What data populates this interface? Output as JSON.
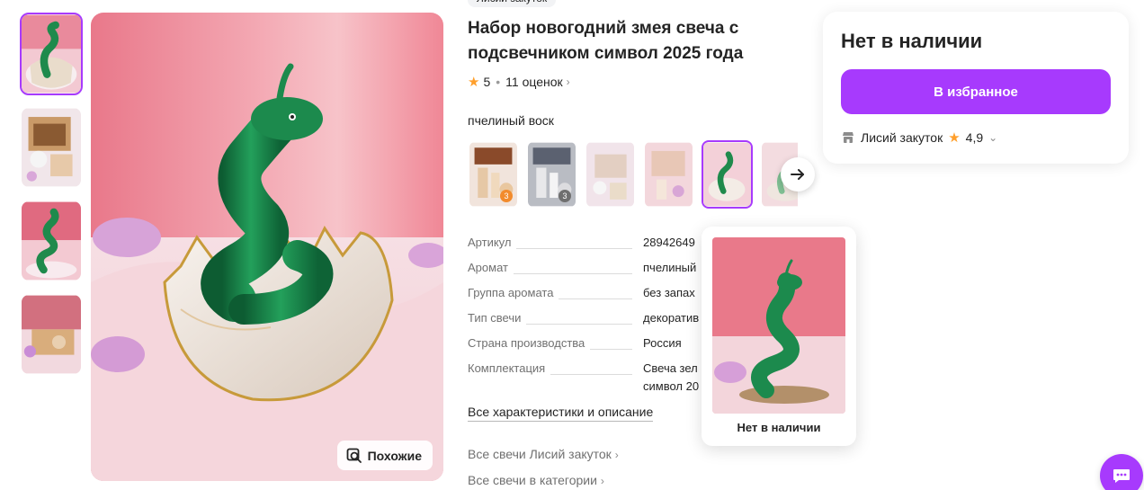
{
  "brand": {
    "label": "Лисий закуток"
  },
  "product": {
    "title": "Набор новогодний змея свеча с подсвечником символ 2025 года",
    "rating": "5",
    "reviews": "11 оценок"
  },
  "gallery": {
    "thumbnails": [
      "snake-in-egg",
      "gift-box",
      "snake-candle",
      "box-with-logo"
    ],
    "similar_label": "Похожие"
  },
  "variants": {
    "label": "пчелиный воск",
    "items": [
      {
        "image": "candles-set-orange",
        "badge": "3"
      },
      {
        "image": "candles-set-grey",
        "badge": "3"
      },
      {
        "image": "gift-box"
      },
      {
        "image": "candles-box"
      },
      {
        "image": "snake-in-egg"
      },
      {
        "image": "snake-partial"
      }
    ]
  },
  "specs": [
    {
      "key": "Артикул",
      "value": "28942649"
    },
    {
      "key": "Аромат",
      "value": "пчелиный"
    },
    {
      "key": "Группа аромата",
      "value": "без запах"
    },
    {
      "key": "Тип свечи",
      "value": "декоратив"
    },
    {
      "key": "Страна производства",
      "value": "Россия"
    },
    {
      "key": "Комплектация",
      "value": "Свеча зел символ 20"
    }
  ],
  "links": {
    "all_specs": "Все характеристики и описание",
    "all_seller": "Все свечи Лисий закуток",
    "all_category": "Все свечи в категории"
  },
  "popup": {
    "label": "Нет в наличии"
  },
  "buybox": {
    "stock": "Нет в наличии",
    "favorite": "В избранное",
    "seller": "Лисий закуток",
    "seller_rating": "4,9"
  },
  "colors": {
    "accent": "#a73afd",
    "star": "#ff9f2b"
  }
}
